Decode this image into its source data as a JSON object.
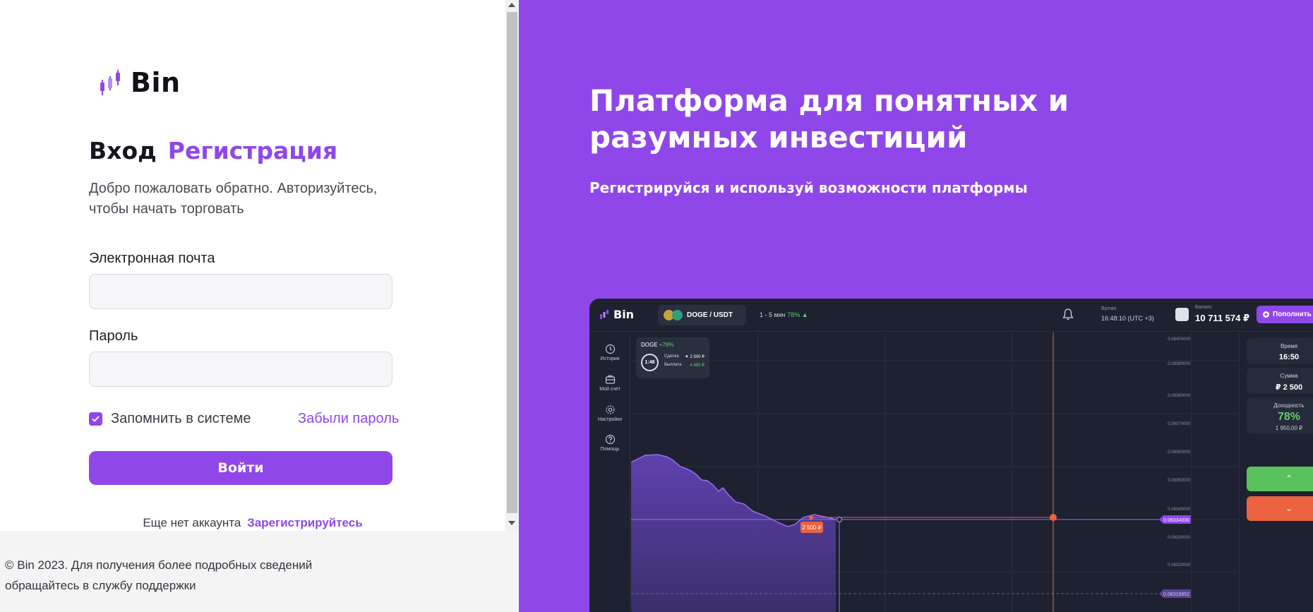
{
  "brand": {
    "name": "Bin"
  },
  "auth": {
    "tab_login": "Вход",
    "tab_register": "Регистрация",
    "welcome": "Добро пожаловать обратно. Авторизуйтесь, чтобы начать торговать",
    "email_label": "Электронная почта",
    "email_value": "",
    "password_label": "Пароль",
    "password_value": "",
    "remember_label": "Запомнить в системе",
    "remember_checked": true,
    "forgot_label": "Забыли пароль",
    "login_button": "Войти",
    "no_account_text": "Еще нет аккаунта",
    "signup_link": "Зарегистрируйтесь"
  },
  "footer": {
    "text": "© Bin 2023. Для получения более подробных сведений обращайтесь в службу поддержки"
  },
  "hero": {
    "title": "Платформа для понятных и разумных инвестиций",
    "subtitle": "Регистрируйся и используй возможности платформы"
  },
  "preview": {
    "logo": "Bin",
    "pair": "DOGE / USDT",
    "timeframe": "1 - 5 мин",
    "timeframe_pct": "78% ▲",
    "time_label": "Время",
    "time_value": "16:48:10 (UTC +3)",
    "balance_label": "Баланс",
    "balance_value": "10 711 574 ₽",
    "deposit_button": "Пополнить",
    "sidebar": [
      "История",
      "Мой счет",
      "Настройки",
      "Помощь"
    ],
    "deal": {
      "symbol": "DOGE",
      "pct": "+78%",
      "timer": "1:48",
      "deal_label": "Сделка",
      "deal_value": "▼ 2 500 ₽",
      "payout_label": "Выплата",
      "payout_value": "4 450 ₽"
    },
    "panel": {
      "time_label": "Время",
      "time_value": "16:50",
      "amount_label": "Сумма",
      "amount_value": "₽ 2 500",
      "profit_label": "Доходность",
      "profit_value": "78%",
      "profit_amount": "1 950,00 ₽"
    },
    "price_ticks": [
      "0.08400000",
      "0.08390000",
      "0.08380000",
      "0.08370000",
      "0.08360000",
      "0.08350000",
      "0.08340000",
      "0.08330000",
      "0.08320000"
    ],
    "current_price": "0.08334000",
    "secondary_price": "0.08319952",
    "trade_marker": "2 500 ₽",
    "colors": {
      "accent": "#8f47e9",
      "up": "#5ac25c",
      "down": "#ec6341",
      "dark": "#1d2130"
    }
  }
}
